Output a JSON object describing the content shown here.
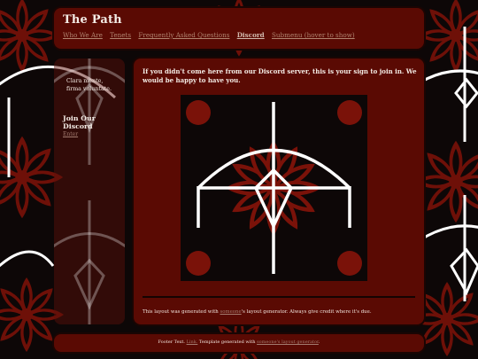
{
  "header": {
    "title": "The Path",
    "nav": [
      "Who We Are",
      "Tenets",
      "Frequently Asked Questions",
      "Discord",
      "Submenu (hover to show)"
    ]
  },
  "sidebar": {
    "quote_line1": "Clara mente,",
    "quote_line2": "firma voluntate.",
    "join_title": "Join Our Discord",
    "join_link": "Enter"
  },
  "main": {
    "intro": "If you didn't come here from our Discord server, this is your sign to join in. We would be happy to have you.",
    "credit_before": "This layout was generated with ",
    "credit_link": "someone",
    "credit_after": "'s layout generator. Always give credit where it's due."
  },
  "footer": {
    "text_before": "Footer Text. ",
    "link1": "Link.",
    "text_middle": " Template generated with ",
    "link2": "someone's layout generator",
    "text_after": "."
  },
  "colors": {
    "page_background": "#0d0707",
    "panel_red": "#5a0a03",
    "pattern_red": "#6e1008",
    "link": "#b0836f",
    "text": "#f4ece6"
  },
  "icons": [
    "bow-arrow-emblem",
    "mandala-pattern"
  ]
}
